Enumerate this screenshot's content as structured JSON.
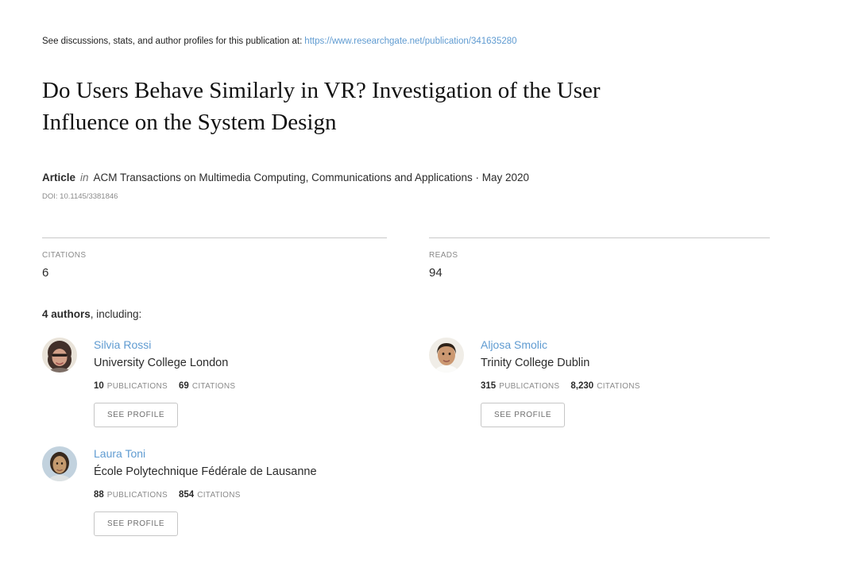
{
  "colors": {
    "link": "#5f9bd1"
  },
  "header": {
    "note": "See discussions, stats, and author profiles for this publication at:",
    "link": "https://www.researchgate.net/publication/341635280"
  },
  "title_lines": [
    "Do Users Behave Similarly in VR? Investigation of the User",
    "Influence on the System Design"
  ],
  "meta": {
    "type_label": "Article",
    "in_label": "in",
    "journal": "ACM Transactions on Multimedia Computing, Communications and Applications · May 2020",
    "doi": "DOI: 10.1145/3381846"
  },
  "stats": {
    "citations_label": "CITATIONS",
    "citations_value": "6",
    "reads_label": "READS",
    "reads_value": "94"
  },
  "authors_section": {
    "heading_bold": "4 authors",
    "heading_rest": ", including:"
  },
  "labels": {
    "publications": "PUBLICATIONS",
    "citations": "CITATIONS",
    "see_profile": "SEE PROFILE"
  },
  "authors": [
    {
      "name": "Silvia Rossi",
      "affiliation": "University College London",
      "publications": "10",
      "citations": "69"
    },
    {
      "name": "Aljosa Smolic",
      "affiliation": "Trinity College Dublin",
      "publications": "315",
      "citations": "8,230"
    },
    {
      "name": "Laura Toni",
      "affiliation": "École Polytechnique Fédérale de Lausanne",
      "publications": "88",
      "citations": "854"
    }
  ]
}
